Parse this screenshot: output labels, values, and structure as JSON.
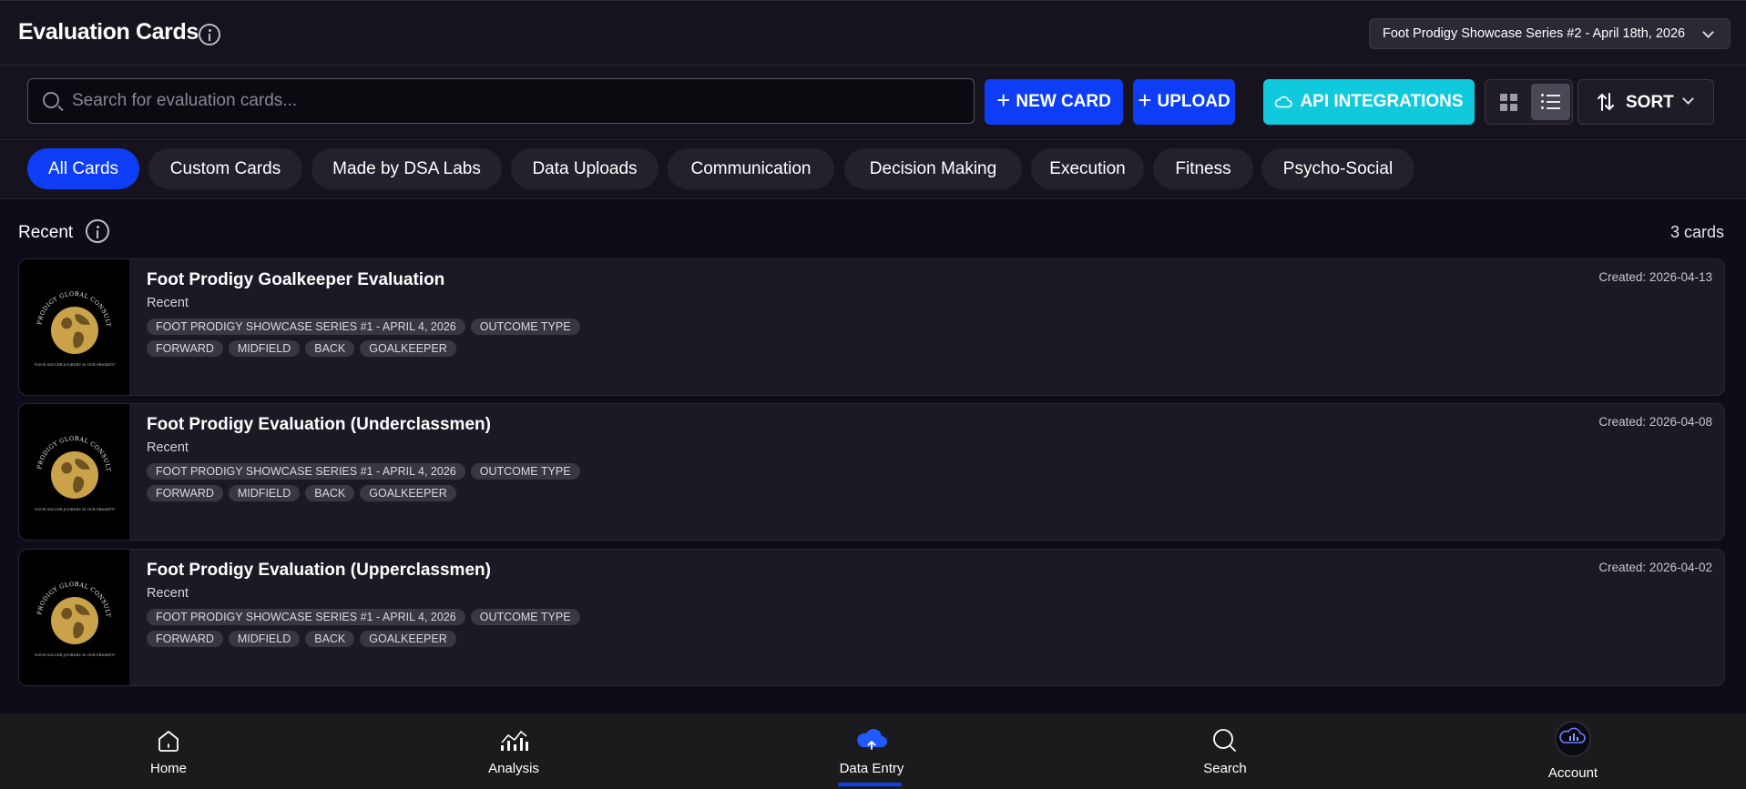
{
  "header": {
    "title": "Evaluation Cards",
    "event_select": "Foot Prodigy Showcase Series #2 - April 18th, 2026"
  },
  "toolbar": {
    "search_placeholder": "Search for evaluation cards...",
    "new_card_label": "NEW CARD",
    "upload_label": "UPLOAD",
    "api_label": "API INTEGRATIONS",
    "sort_label": "SORT",
    "active_view": "list"
  },
  "filters": {
    "chips": [
      "All Cards",
      "Custom Cards",
      "Made by DSA Labs",
      "Data Uploads",
      "Communication",
      "Decision Making",
      "Execution",
      "Fitness",
      "Psycho-Social"
    ],
    "active": "All Cards"
  },
  "recent": {
    "title": "Recent",
    "count": "3 cards",
    "cards": [
      {
        "title": "Foot Prodigy Goalkeeper Evaluation",
        "subtitle": "Recent",
        "created": "Created: 2026-04-13",
        "tags_top": [
          "FOOT PRODIGY SHOWCASE SERIES #1 - APRIL 4, 2026",
          "OUTCOME TYPE"
        ],
        "tags_bottom": [
          "FORWARD",
          "MIDFIELD",
          "BACK",
          "GOALKEEPER"
        ],
        "logo_text": "FOOT PRODIGY GLOBAL CONSULTANCY",
        "logo_tagline": "\"YOUR SOCCER JOURNEY IS OUR PRIORITY\""
      },
      {
        "title": "Foot Prodigy Evaluation (Underclassmen)",
        "subtitle": "Recent",
        "created": "Created: 2026-04-08",
        "tags_top": [
          "FOOT PRODIGY SHOWCASE SERIES #1 - APRIL 4, 2026",
          "OUTCOME TYPE"
        ],
        "tags_bottom": [
          "FORWARD",
          "MIDFIELD",
          "BACK",
          "GOALKEEPER"
        ],
        "logo_text": "FOOT PRODIGY GLOBAL CONSULTANCY",
        "logo_tagline": "\"YOUR SOCCER JOURNEY IS OUR PRIORITY\""
      },
      {
        "title": "Foot Prodigy Evaluation (Upperclassmen)",
        "subtitle": "Recent",
        "created": "Created: 2026-04-02",
        "tags_top": [
          "FOOT PRODIGY SHOWCASE SERIES #1 - APRIL 4, 2026",
          "OUTCOME TYPE"
        ],
        "tags_bottom": [
          "FORWARD",
          "MIDFIELD",
          "BACK",
          "GOALKEEPER"
        ],
        "logo_text": "FOOT PRODIGY GLOBAL CONSULTANCY",
        "logo_tagline": "\"YOUR SOCCER JOURNEY IS OUR PRIORITY\""
      }
    ]
  },
  "bottom_nav": {
    "items": [
      {
        "label": "Home",
        "icon": "home-icon"
      },
      {
        "label": "Analysis",
        "icon": "analysis-icon"
      },
      {
        "label": "Data Entry",
        "icon": "cloud-upload-icon",
        "active": true
      },
      {
        "label": "Search",
        "icon": "search-icon"
      },
      {
        "label": "Account",
        "icon": "account-avatar"
      }
    ]
  },
  "colors": {
    "accent_blue": "#0d3ef5",
    "accent_cyan": "#11c9dd",
    "background": "#0f0c17",
    "card": "#1c1924",
    "gold": "#c9a24a"
  }
}
